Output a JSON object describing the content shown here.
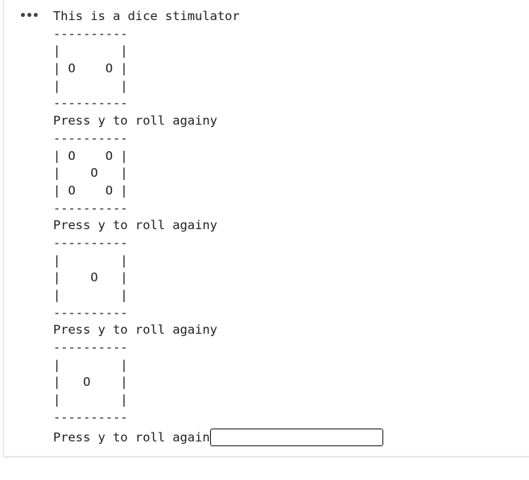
{
  "output_menu_icon": "more-horizontal-icon",
  "output_menu_glyph": "•••",
  "output_lines": [
    "This is a dice stimulator",
    "----------",
    "|        |",
    "| O    O |",
    "|        |",
    "----------",
    "Press y to roll againy",
    "----------",
    "| O    O |",
    "|    O   |",
    "| O    O |",
    "----------",
    "Press y to roll againy",
    "----------",
    "|        |",
    "|    O   |",
    "|        |",
    "----------",
    "Press y to roll againy",
    "----------",
    "|        |",
    "|   O    |",
    "|        |",
    "----------"
  ],
  "prompt": {
    "text": "Press y to roll again",
    "input_value": ""
  }
}
